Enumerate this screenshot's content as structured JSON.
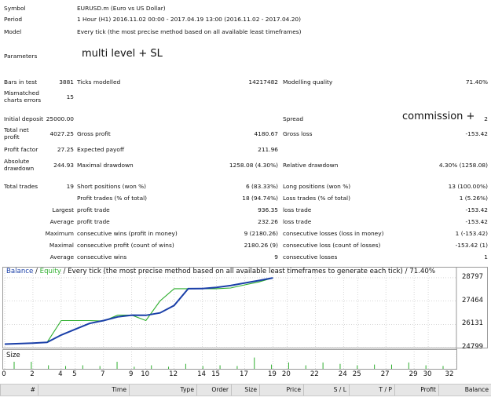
{
  "report": {
    "symbol_label": "Symbol",
    "symbol_value": "EURUSD.m (Euro vs US Dollar)",
    "period_label": "Period",
    "period_value": "1 Hour (H1) 2016.11.02 00:00 - 2017.04.19 13:00 (2016.11.02 - 2017.04.20)",
    "model_label": "Model",
    "model_value": "Every tick (the most precise method based on all available least timeframes)",
    "parameters_label": "Parameters",
    "parameters_value": "multi level + SL",
    "bars_label": "Bars in test",
    "bars_value": "3881",
    "ticks_label": "Ticks modelled",
    "ticks_value": "14217482",
    "quality_label": "Modelling quality",
    "quality_value": "71.40%",
    "mismatch_label": "Mismatched charts errors",
    "mismatch_value": "15",
    "deposit_label": "Initial deposit",
    "deposit_value": "25000.00",
    "spread_label": "Spread",
    "spread_note": "commission +",
    "spread_value": "2",
    "net_label": "Total net profit",
    "net_value": "4027.25",
    "gross_profit_label": "Gross profit",
    "gross_profit_value": "4180.67",
    "gross_loss_label": "Gross loss",
    "gross_loss_value": "-153.42",
    "pf_label": "Profit factor",
    "pf_value": "27.25",
    "payoff_label": "Expected payoff",
    "payoff_value": "211.96",
    "abs_dd_label": "Absolute drawdown",
    "abs_dd_value": "244.93",
    "max_dd_label": "Maximal drawdown",
    "max_dd_value": "1258.08 (4.30%)",
    "rel_dd_label": "Relative drawdown",
    "rel_dd_value": "4.30% (1258.08)",
    "trades_label": "Total trades",
    "trades_value": "19",
    "short_label": "Short positions (won %)",
    "short_value": "6 (83.33%)",
    "long_label": "Long positions (won %)",
    "long_value": "13 (100.00%)",
    "profit_trades_label": "Profit trades (% of total)",
    "profit_trades_value": "18 (94.74%)",
    "loss_trades_label": "Loss trades (% of total)",
    "loss_trades_value": "1 (5.26%)",
    "largest_label": "Largest",
    "largest_profit_label": "profit trade",
    "largest_profit_value": "936.35",
    "largest_loss_label": "loss trade",
    "largest_loss_value": "-153.42",
    "average_label": "Average",
    "avg_profit_label": "profit trade",
    "avg_profit_value": "232.26",
    "avg_loss_label": "loss trade",
    "avg_loss_value": "-153.42",
    "maximum_label": "Maximum",
    "max_wins_label": "consecutive wins (profit in money)",
    "max_wins_value": "9 (2180.26)",
    "max_losses_label": "consecutive losses (loss in money)",
    "max_losses_value": "1 (-153.42)",
    "maximal_label": "Maximal",
    "maxl_profit_label": "consecutive profit (count of wins)",
    "maxl_profit_value": "2180.26 (9)",
    "maxl_loss_label": "consecutive loss (count of losses)",
    "maxl_loss_value": "-153.42 (1)",
    "avg2_label": "Average",
    "avg_wins_label": "consecutive wins",
    "avg_wins_value": "9",
    "avg_losses_label": "consecutive losses",
    "avg_losses_value": "1"
  },
  "chart_title": {
    "balance": "Balance",
    "sep": " / ",
    "equity": "Equity",
    "rest": " / Every tick (the most precise method based on all available least timeframes to generate each tick) / 71.40%"
  },
  "size_label": "Size",
  "chart_data": {
    "type": "line",
    "x": [
      0,
      1,
      2,
      3,
      4,
      5,
      6,
      7,
      8,
      9,
      10,
      11,
      12,
      13,
      14,
      15,
      16,
      17,
      18,
      19
    ],
    "series": [
      {
        "name": "Balance",
        "color": "#1a3fa8",
        "values": [
          25000,
          25030,
          25060,
          25100,
          25520,
          25850,
          26180,
          26350,
          26560,
          26660,
          26650,
          26790,
          27210,
          28170,
          28180,
          28250,
          28350,
          28500,
          28640,
          28790
        ]
      },
      {
        "name": "Equity",
        "color": "#2eae2e",
        "values": [
          25000,
          25030,
          25060,
          25100,
          26350,
          26350,
          26350,
          26320,
          26660,
          26660,
          26350,
          27470,
          28170,
          28170,
          28170,
          28170,
          28210,
          28390,
          28560,
          28790
        ]
      }
    ],
    "sizes": [
      1,
      1,
      0.5,
      0.4,
      0.5,
      0.4,
      1,
      0.3,
      0.5,
      0.3,
      0.7,
      0.4,
      0.5,
      0.4,
      1.6,
      0.6,
      0.9,
      0.5,
      0.9,
      0.7,
      0.5,
      0.6,
      0.6,
      0.9,
      0.5,
      0.4
    ],
    "ylim": [
      24799,
      29200
    ],
    "y_ticks": [
      "28797",
      "27464",
      "26131",
      "24799"
    ],
    "y_tick_values": [
      28797,
      27464,
      26131,
      24799
    ],
    "x_ticks": [
      "0",
      "2",
      "4",
      "5",
      "7",
      "9",
      "10",
      "12",
      "14",
      "15",
      "17",
      "19",
      "20",
      "22",
      "24",
      "25",
      "27",
      "29",
      "30",
      "32"
    ],
    "xlim": [
      0,
      32
    ],
    "grid": true
  },
  "grid_headers": [
    "#",
    "Time",
    "Type",
    "Order",
    "Size",
    "Price",
    "S / L",
    "T / P",
    "Profit",
    "Balance"
  ],
  "colors": {
    "balance": "#1a3fa8",
    "equity": "#2eae2e",
    "grid": "#bdbdbd"
  }
}
